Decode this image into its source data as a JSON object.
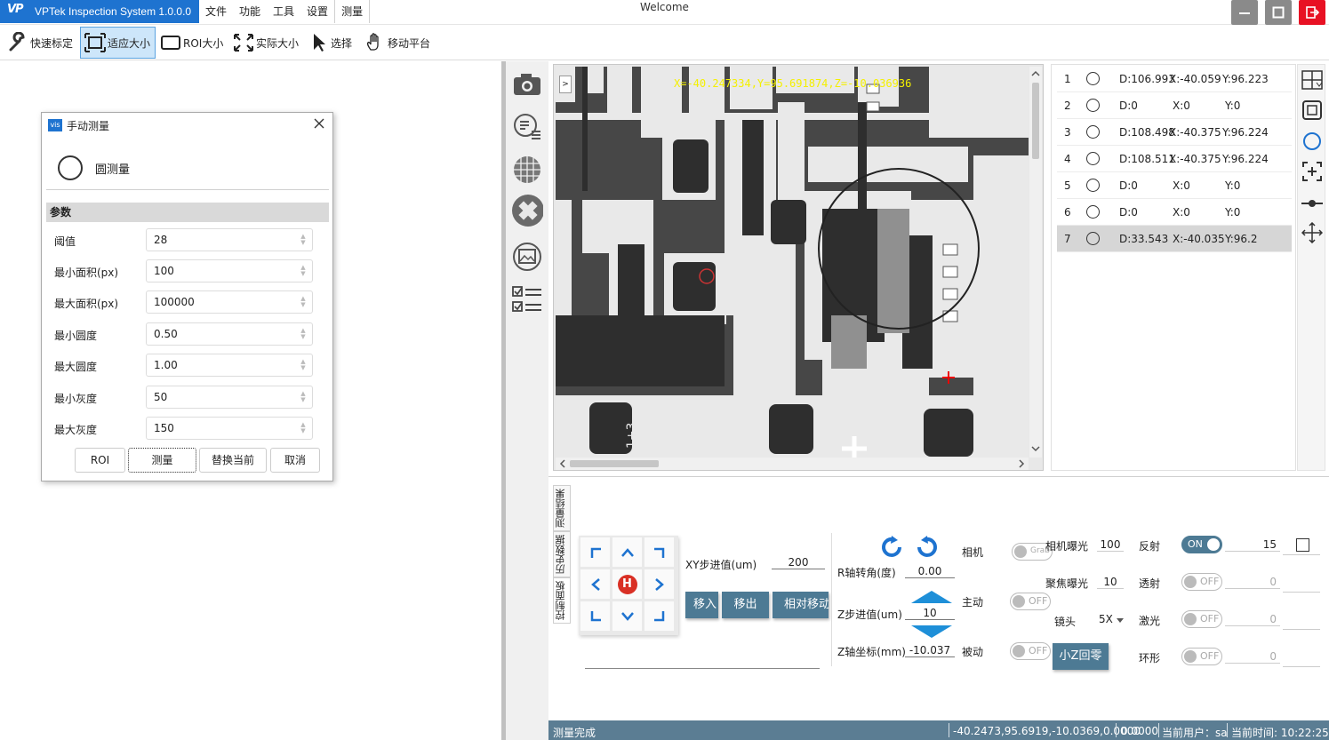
{
  "app": {
    "name": "VPTek Inspection System 1.0.0.0",
    "logo_text": "VP",
    "welcome": "Welcome"
  },
  "menu": [
    "文件",
    "功能",
    "工具",
    "设置",
    "测量"
  ],
  "toolbar": {
    "quick_calib": "快速标定",
    "fit_size": "适应大小",
    "roi_size": "ROI大小",
    "actual_size": "实际大小",
    "select": "选择",
    "move_stage": "移动平台"
  },
  "dialog": {
    "title": "手动测量",
    "logo": "vis",
    "tool_name": "圆测量",
    "params_header": "参数",
    "params": [
      {
        "label": "阈值",
        "value": "28"
      },
      {
        "label": "最小面积(px)",
        "value": "100"
      },
      {
        "label": "最大面积(px)",
        "value": "100000"
      },
      {
        "label": "最小圆度",
        "value": "0.50"
      },
      {
        "label": "最大圆度",
        "value": "1.00"
      },
      {
        "label": "最小灰度",
        "value": "50"
      },
      {
        "label": "最大灰度",
        "value": "150"
      }
    ],
    "buttons": {
      "roi": "ROI",
      "measure": "测量",
      "replace": "替换当前",
      "cancel": "取消"
    }
  },
  "viewer": {
    "toggle": ">",
    "coord_readout": "X=-40.247334,Y=95.691874,Z=-10.036936"
  },
  "results": [
    {
      "num": "1",
      "d": "D:106.993",
      "x": "X:-40.059",
      "y": "Y:96.223"
    },
    {
      "num": "2",
      "d": "D:0",
      "x": "X:0",
      "y": "Y:0"
    },
    {
      "num": "3",
      "d": "D:108.498",
      "x": "X:-40.375",
      "y": "Y:96.224"
    },
    {
      "num": "4",
      "d": "D:108.511",
      "x": "X:-40.375",
      "y": "Y:96.224"
    },
    {
      "num": "5",
      "d": "D:0",
      "x": "X:0",
      "y": "Y:0"
    },
    {
      "num": "6",
      "d": "D:0",
      "x": "X:0",
      "y": "Y:0"
    },
    {
      "num": "7",
      "d": "D:33.543",
      "x": "X:-40.035",
      "y": "Y:96.2"
    }
  ],
  "tabs": [
    "控制面板",
    "历史数据",
    "测量结果"
  ],
  "control": {
    "home_label": "H",
    "xy_step_label": "XY步进值(um)",
    "xy_step_value": "200",
    "btn_move_in": "移入",
    "btn_move_out": "移出",
    "btn_relative": "相对移动",
    "r_angle_label": "R轴转角(度)",
    "r_angle_value": "0.00",
    "z_step_label": "Z步进值(um)",
    "z_step_value": "10",
    "z_coord_label": "Z轴坐标(mm)",
    "z_coord_value": "-10.037",
    "camera_label": "相机",
    "camera_toggle": "Grab",
    "active_label": "主动",
    "active_toggle": "OFF",
    "passive_label": "被动",
    "passive_toggle": "OFF",
    "z_zero_btn": "小Z回零",
    "cam_exposure_label": "相机曝光",
    "cam_exposure_value": "100",
    "focus_exposure_label": "聚焦曝光",
    "focus_exposure_value": "10",
    "lens_label": "镜头",
    "lens_value": "5X",
    "lights": [
      {
        "label": "反射",
        "state": "ON",
        "value": "15"
      },
      {
        "label": "透射",
        "state": "OFF",
        "value": "0"
      },
      {
        "label": "激光",
        "state": "OFF",
        "value": "0"
      },
      {
        "label": "环形",
        "state": "OFF",
        "value": "0"
      }
    ]
  },
  "status": {
    "message": "测量完成",
    "position": "-40.2473,95.6919,-10.0369,0.0000",
    "value": "0.0000",
    "user": "当前用户：sa",
    "time": "当前时间:  10:22:25"
  },
  "colors": {
    "title_blue": "#1e73d0",
    "accent": "#4d7a94",
    "close_red": "#e81123",
    "readout_yellow": "#f4f000"
  }
}
